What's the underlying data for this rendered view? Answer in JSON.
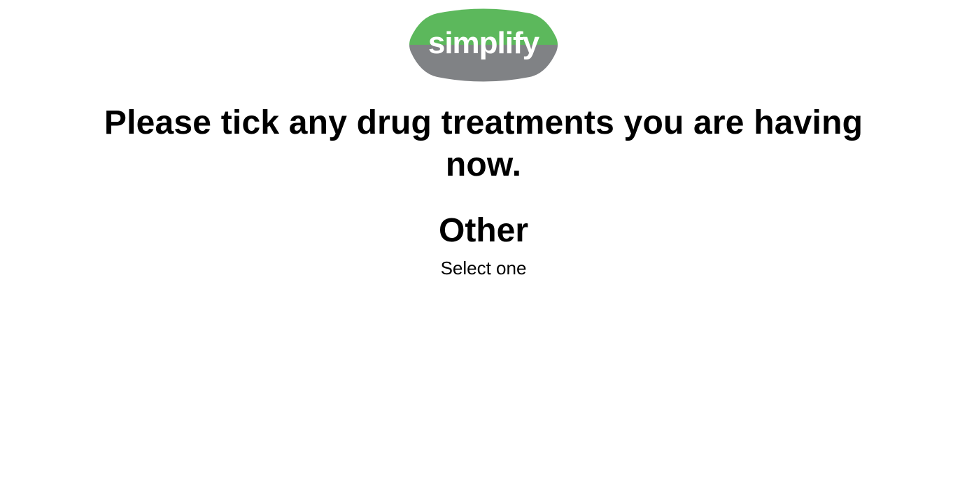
{
  "brand": {
    "logo_text": "simplify",
    "logo_icon": "simplify-logo",
    "colors": {
      "logo_top": "#5cb85c",
      "logo_bottom": "#808285",
      "logo_text": "#ffffff"
    }
  },
  "question": {
    "text": "Please tick any drug treatments you are having now."
  },
  "section": {
    "title": "Other",
    "hint": "Select one"
  }
}
